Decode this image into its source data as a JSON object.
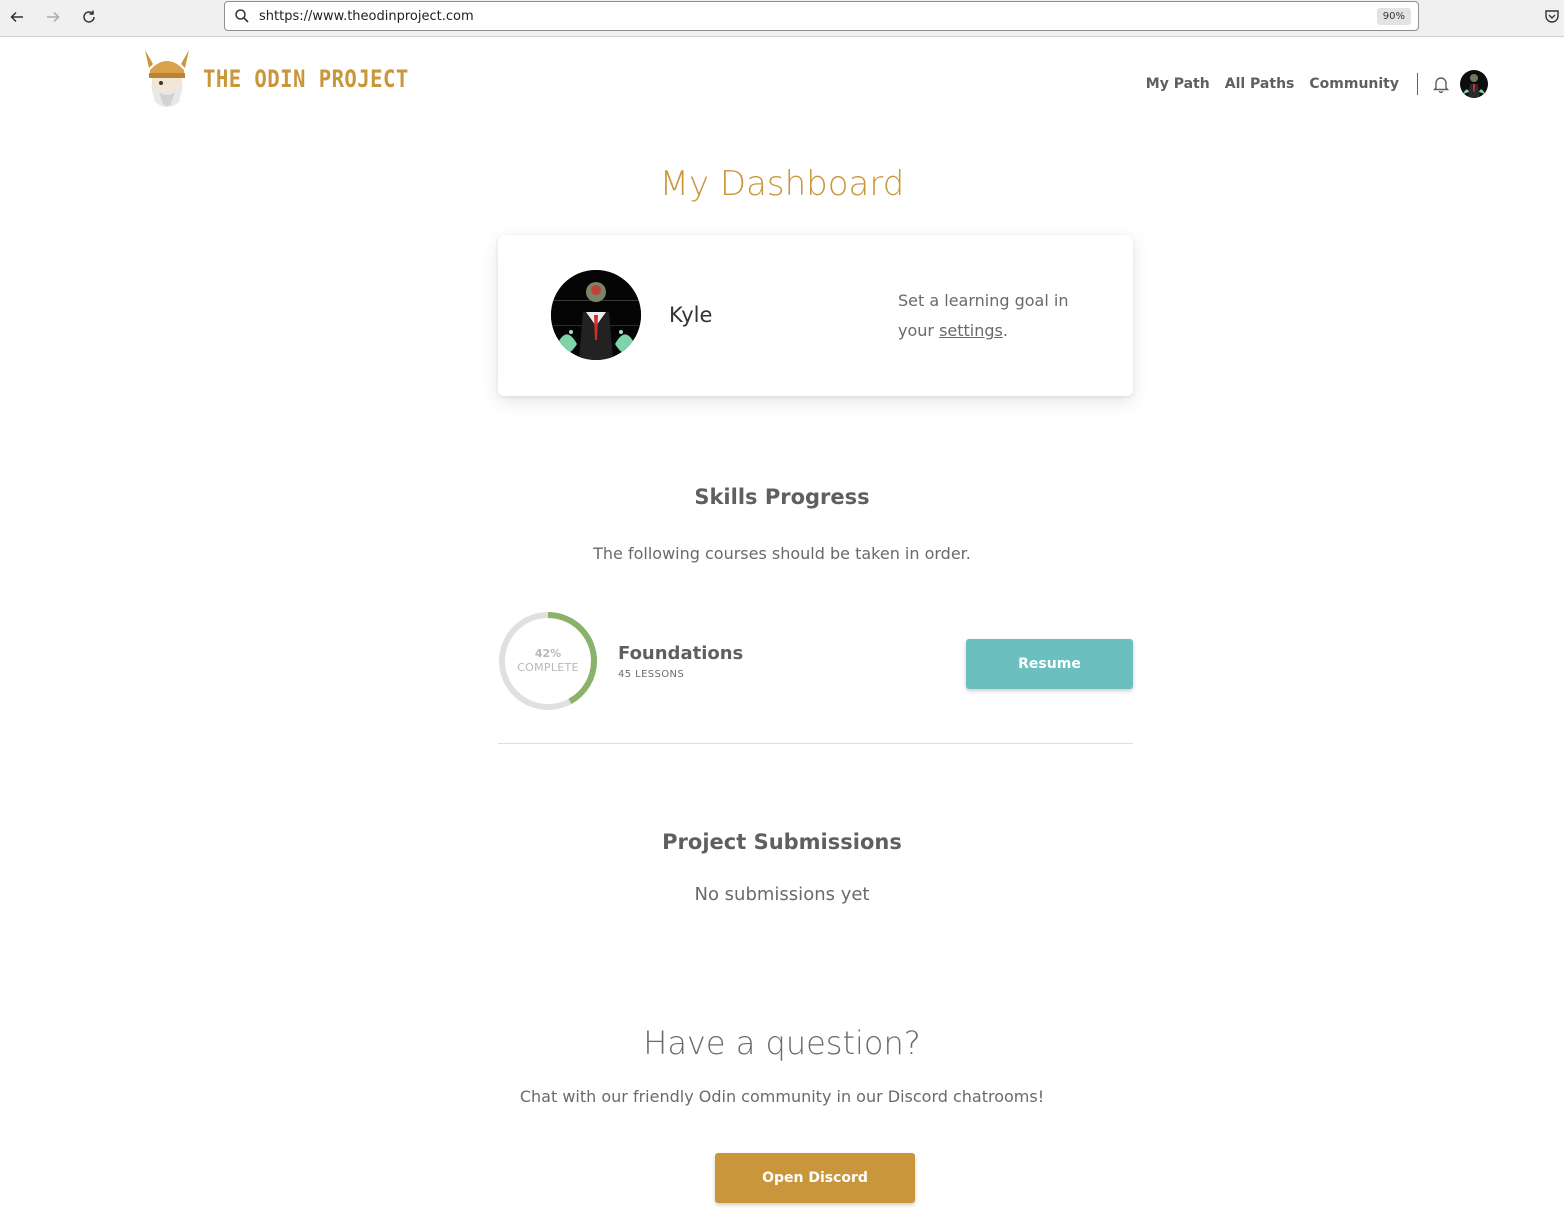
{
  "browser": {
    "url": "shttps://www.theodinproject.com",
    "zoom": "90%",
    "icons": [
      "back-arrow-icon",
      "forward-arrow-icon",
      "reload-icon",
      "search-icon",
      "pocket-icon"
    ]
  },
  "header": {
    "logo_text": "THE ODIN PROJECT",
    "nav": [
      "My Path",
      "All Paths",
      "Community"
    ],
    "icons": [
      "odin-logo-icon",
      "bell-icon",
      "avatar"
    ]
  },
  "page": {
    "title": "My Dashboard"
  },
  "profile": {
    "name": "Kyle",
    "goal_prefix": "Set a learning goal in your ",
    "goal_link": "settings",
    "goal_suffix": "."
  },
  "skills": {
    "title": "Skills Progress",
    "subtitle": "The following courses should be taken in order.",
    "courses": [
      {
        "name": "Foundations",
        "lessons": "45 LESSONS",
        "percent_text": "42%",
        "percent_label": "COMPLETE",
        "progress": 0.42,
        "action": "Resume"
      }
    ]
  },
  "submissions": {
    "title": "Project Submissions",
    "empty": "No submissions yet"
  },
  "question": {
    "title": "Have a question?",
    "subtitle": "Chat with our friendly Odin community in our Discord chatrooms!",
    "button": "Open Discord"
  },
  "colors": {
    "brand_gold": "#c9963c",
    "teal": "#6bbfbf",
    "progress_green": "#8bb26a",
    "progress_track": "#e0e0e0"
  }
}
